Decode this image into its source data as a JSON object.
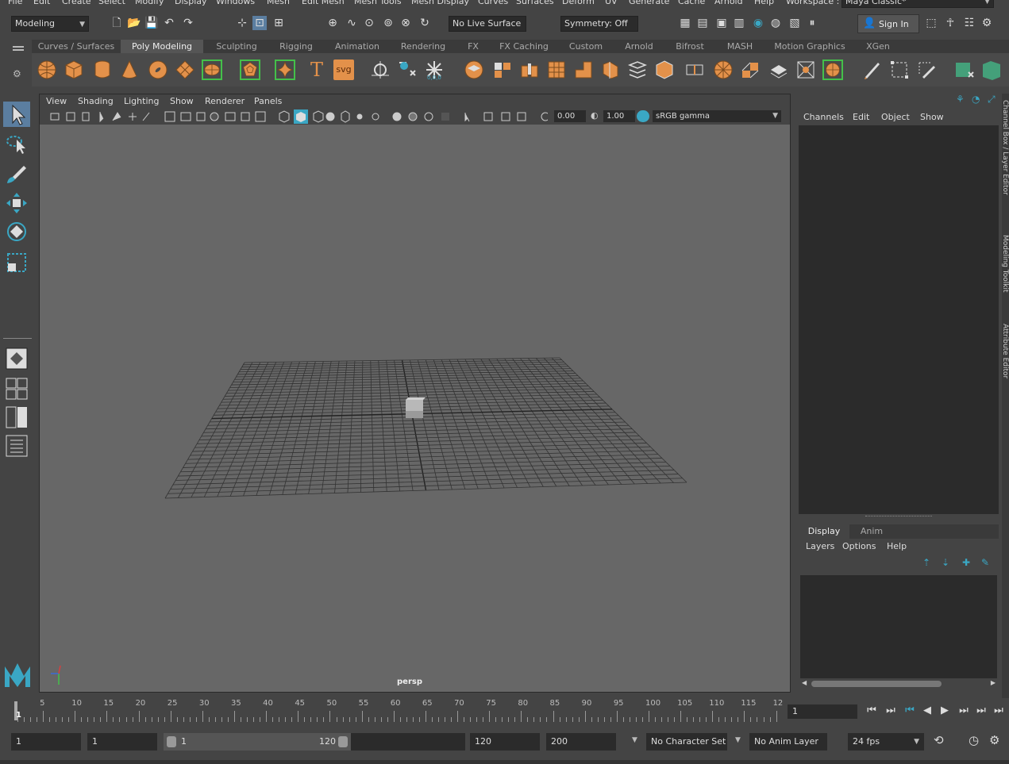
{
  "menubar": {
    "items": [
      "File",
      "Edit",
      "Create",
      "Select",
      "Modify",
      "Display",
      "Windows",
      "Mesh",
      "Edit Mesh",
      "Mesh Tools",
      "Mesh Display",
      "Curves",
      "Surfaces",
      "Deform",
      "UV",
      "Generate",
      "Cache",
      "Arnold",
      "Help"
    ],
    "workspace_label": "Workspace :",
    "workspace_value": "Maya Classic*"
  },
  "status": {
    "mode": "Modeling",
    "live_surface": "No Live Surface",
    "symmetry": "Symmetry: Off",
    "sign_in": "Sign In"
  },
  "shelf_tabs": [
    "Curves / Surfaces",
    "Poly Modeling",
    "Sculpting",
    "Rigging",
    "Animation",
    "Rendering",
    "FX",
    "FX Caching",
    "Custom",
    "Arnold",
    "Bifrost",
    "MASH",
    "Motion Graphics",
    "XGen"
  ],
  "shelf_icon_text": {
    "text_tool": "T",
    "svg_tool": "svg"
  },
  "viewport": {
    "menu": [
      "View",
      "Shading",
      "Lighting",
      "Show",
      "Renderer",
      "Panels"
    ],
    "exposure": "0.00",
    "gamma": "1.00",
    "color_space": "sRGB gamma",
    "camera_label": "persp"
  },
  "channel_box": {
    "menu": [
      "Channels",
      "Edit",
      "Object",
      "Show"
    ]
  },
  "layer_editor": {
    "tabs": [
      "Display",
      "Anim"
    ],
    "menu": [
      "Layers",
      "Options",
      "Help"
    ]
  },
  "side_strip": {
    "labels": [
      "Channel Box / Layer Editor",
      "Modeling Toolkit",
      "Attribute Editor"
    ]
  },
  "timeline": {
    "ticks": [
      "5",
      "10",
      "15",
      "20",
      "25",
      "30",
      "35",
      "40",
      "45",
      "50",
      "55",
      "60",
      "65",
      "70",
      "75",
      "80",
      "85",
      "90",
      "95",
      "100",
      "105",
      "110",
      "115",
      "12"
    ],
    "current_frame": "1",
    "current_frame_field": "1"
  },
  "range": {
    "start": "1",
    "playback_start": "1",
    "slider_start": "1",
    "slider_end": "120",
    "playback_end": "120",
    "end": "200",
    "character_set": "No Character Set",
    "anim_layer": "No Anim Layer",
    "fps": "24 fps"
  },
  "colors": {
    "accent": "#5b7ea0",
    "shelf_orange": "#e3914a",
    "maya_logo": "#3aa7c4"
  }
}
